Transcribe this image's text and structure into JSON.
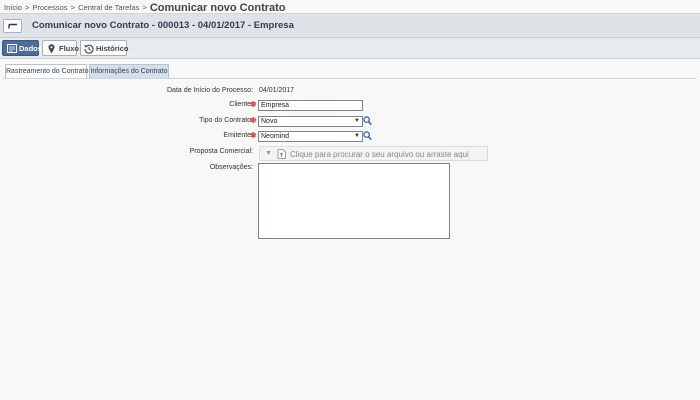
{
  "breadcrumb": {
    "items": [
      "Início",
      "Processos",
      "Central de Tarefas"
    ],
    "separator": ">",
    "current": "Comunicar novo Contrato"
  },
  "header": {
    "title": "Comunicar novo Contrato - 000013 - 04/01/2017 - Empresa",
    "back_icon": "back-arrow-icon"
  },
  "toolbar": {
    "dados_label": "Dados",
    "fluxo_label": "Fluxo",
    "historico_label": "Histórico",
    "active": "Dados",
    "active_color": "#4e6c99"
  },
  "tabs": [
    {
      "label": "Rastreamento do Contrato",
      "active": true
    },
    {
      "label": "Informações do Contrato",
      "active": false
    }
  ],
  "form": {
    "data_inicio": {
      "label": "Data de Início do Processo:",
      "value": "04/01/2017"
    },
    "cliente": {
      "label": "Cliente:",
      "value": "Empresa",
      "required": true
    },
    "tipo_contrato": {
      "label": "Tipo do Contrato:",
      "value": "Novo",
      "required": true
    },
    "emitente": {
      "label": "Emitente:",
      "value": "Neomind",
      "required": true
    },
    "proposta_comercial": {
      "label": "Proposta Comercial:",
      "dropzone_text": "Clique para procurar o seu arquivo ou arraste aqui"
    },
    "observacoes": {
      "label": "Observações:",
      "value": ""
    }
  },
  "required_marker": "✱",
  "colors": {
    "required": "#d9534f",
    "lookup_icon": "#2f5fa8",
    "tab_inactive_bg": "#d5dfea"
  }
}
